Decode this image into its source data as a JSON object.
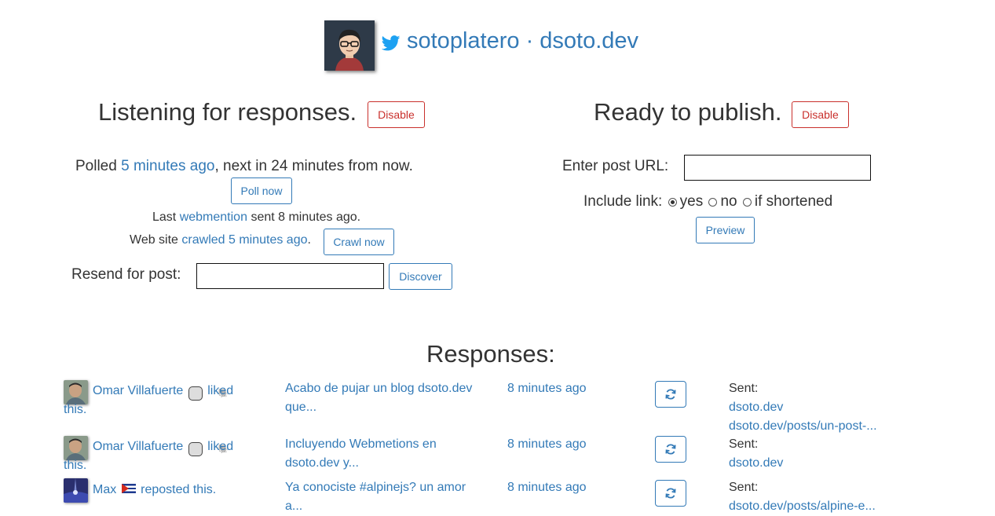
{
  "header": {
    "username": "sotoplatero",
    "separator": "·",
    "site": "dsoto.dev",
    "twitter_color": "#1da1f2"
  },
  "listen": {
    "heading": "Listening for responses.",
    "disable_label": "Disable",
    "polled_prefix": "Polled",
    "polled_link": "5 minutes ago",
    "polled_suffix": ", next in 24 minutes from now.",
    "poll_now_label": "Poll now",
    "last_prefix": "Last",
    "last_link": "webmention",
    "last_suffix": "sent 8 minutes ago.",
    "web_prefix": "Web site",
    "web_link": "crawled 5 minutes ago",
    "web_suffix": ".",
    "crawl_now_label": "Crawl now",
    "resend_label": "Resend for post:",
    "resend_value": "",
    "discover_label": "Discover"
  },
  "publish": {
    "heading": "Ready to publish.",
    "disable_label": "Disable",
    "url_label": "Enter post URL:",
    "url_value": "",
    "include_label": "Include link:",
    "opt_yes": "yes",
    "opt_no": "no",
    "opt_shortened": "if shortened",
    "selected": "yes",
    "preview_label": "Preview"
  },
  "responses": {
    "heading": "Responses:",
    "items": [
      {
        "author": "Omar Villafuerte",
        "badge_icon": "mastodon-icon",
        "action": "liked",
        "action_tail": "this.",
        "post": "Acabo de pujar un blog dsoto.dev",
        "post_tail": "que...",
        "time": "8 minutes ago",
        "sent_label": "Sent:",
        "sent_links": [
          "dsoto.dev",
          "dsoto.dev/posts/un-post-..."
        ]
      },
      {
        "author": "Omar Villafuerte",
        "badge_icon": "mastodon-icon",
        "action": "liked",
        "action_tail": "this.",
        "post": "Incluyendo Webmetions en",
        "post_tail": "dsoto.dev y...",
        "time": "8 minutes ago",
        "sent_label": "Sent:",
        "sent_links": [
          "dsoto.dev"
        ]
      },
      {
        "author": "Max",
        "badge_icon": "cuba-flag-icon",
        "action": "reposted this.",
        "action_tail": "",
        "post": "Ya conociste #alpinejs? un amor",
        "post_tail": "a...",
        "time": "8 minutes ago",
        "sent_label": "Sent:",
        "sent_links": [
          "dsoto.dev/posts/alpine-e..."
        ]
      }
    ]
  }
}
